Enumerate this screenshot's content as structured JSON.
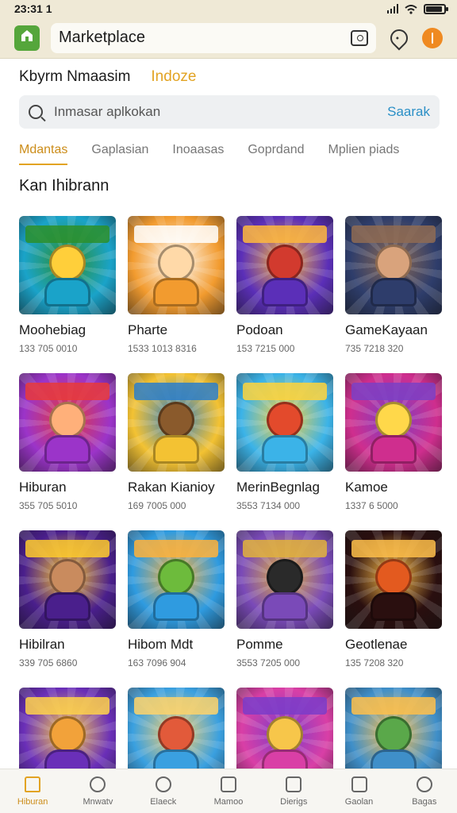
{
  "status": {
    "time": "23:31 1"
  },
  "appbar": {
    "title": "Marketplace",
    "icons": [
      "home-icon",
      "tabs-icon",
      "pin-icon",
      "profile-icon"
    ],
    "home_color": "#55a63b",
    "profile_color": "#ef8a21"
  },
  "header": {
    "label": "Kbyrm Nmaasim",
    "accent_label": "Indoze",
    "accent_color": "#e2a323"
  },
  "search": {
    "placeholder": "Inmasar aplkokan",
    "button": "Saarak"
  },
  "tabs": [
    {
      "label": "Mdantas",
      "active": true
    },
    {
      "label": "Gaplasian",
      "active": false
    },
    {
      "label": "Inoaasas",
      "active": false
    },
    {
      "label": "Goprdand",
      "active": false
    },
    {
      "label": "Mplien piads",
      "active": false
    }
  ],
  "category": {
    "title": "Kan Ihibrann"
  },
  "apps": [
    {
      "name": "Moohebiag",
      "meta": "133 705 0010",
      "colors": [
        "#1aa3c9",
        "#ffcf3a",
        "#2c8f2a"
      ]
    },
    {
      "name": "Pharte",
      "meta": "1533 1013 8316",
      "colors": [
        "#f29b2f",
        "#ffd9a8",
        "#ffffff"
      ]
    },
    {
      "name": "Podoan",
      "meta": "153 7215 000",
      "colors": [
        "#5b2fb8",
        "#d23a2e",
        "#ffb93c"
      ]
    },
    {
      "name": "GameKayaan",
      "meta": "735 7218 320",
      "colors": [
        "#2e3d6b",
        "#d9a37c",
        "#8f6b52"
      ]
    },
    {
      "name": "Hiburan",
      "meta": "355 705 5010",
      "colors": [
        "#9b34c9",
        "#ffb07a",
        "#e73a3a"
      ]
    },
    {
      "name": "Rakan Kianioy",
      "meta": "169 7005 000",
      "colors": [
        "#f3c233",
        "#8a5a2c",
        "#2c7ec9"
      ]
    },
    {
      "name": "MerinBegnlag",
      "meta": "3553 7134 000",
      "colors": [
        "#3bb3e8",
        "#e34a2c",
        "#ffd33b"
      ]
    },
    {
      "name": "Kamoe",
      "meta": "1337 6 5000",
      "colors": [
        "#cf2e8e",
        "#ffd84a",
        "#7b3fc4"
      ]
    },
    {
      "name": "Hibilran",
      "meta": "339 705 6860",
      "colors": [
        "#4a1f8c",
        "#c98b5e",
        "#ffcb2b"
      ]
    },
    {
      "name": "Hibom Mdt",
      "meta": "163 7096 904",
      "colors": [
        "#2f9be0",
        "#6dbb3c",
        "#ffb13a"
      ]
    },
    {
      "name": "Pomme",
      "meta": "3553 7205 000",
      "colors": [
        "#7a4ab8",
        "#2a2a2a",
        "#e2b13c"
      ]
    },
    {
      "name": "Geotlenae",
      "meta": "135 7208 320",
      "colors": [
        "#2a0f0f",
        "#e35a1f",
        "#ffc04a"
      ]
    },
    {
      "name": "",
      "meta": "",
      "colors": [
        "#6a2fb8",
        "#f2a23a",
        "#ffd24a"
      ]
    },
    {
      "name": "",
      "meta": "",
      "colors": [
        "#3aa0e0",
        "#e25a3a",
        "#ffd36a"
      ]
    },
    {
      "name": "",
      "meta": "",
      "colors": [
        "#d93fa6",
        "#f7c64a",
        "#7a3cc9"
      ]
    },
    {
      "name": "",
      "meta": "",
      "colors": [
        "#3f8fc9",
        "#5aa84a",
        "#ffc04a"
      ]
    }
  ],
  "nav": [
    {
      "label": "Hiburan",
      "icon": "home-icon",
      "active": true
    },
    {
      "label": "Mnwatv",
      "icon": "clock-icon",
      "active": false
    },
    {
      "label": "Elaeck",
      "icon": "search-icon",
      "active": false
    },
    {
      "label": "Mamoo",
      "icon": "document-icon",
      "active": false
    },
    {
      "label": "Dierigs",
      "icon": "people-icon",
      "active": false
    },
    {
      "label": "Gaolan",
      "icon": "image-icon",
      "active": false
    },
    {
      "label": "Bagas",
      "icon": "user-icon",
      "active": false
    }
  ]
}
